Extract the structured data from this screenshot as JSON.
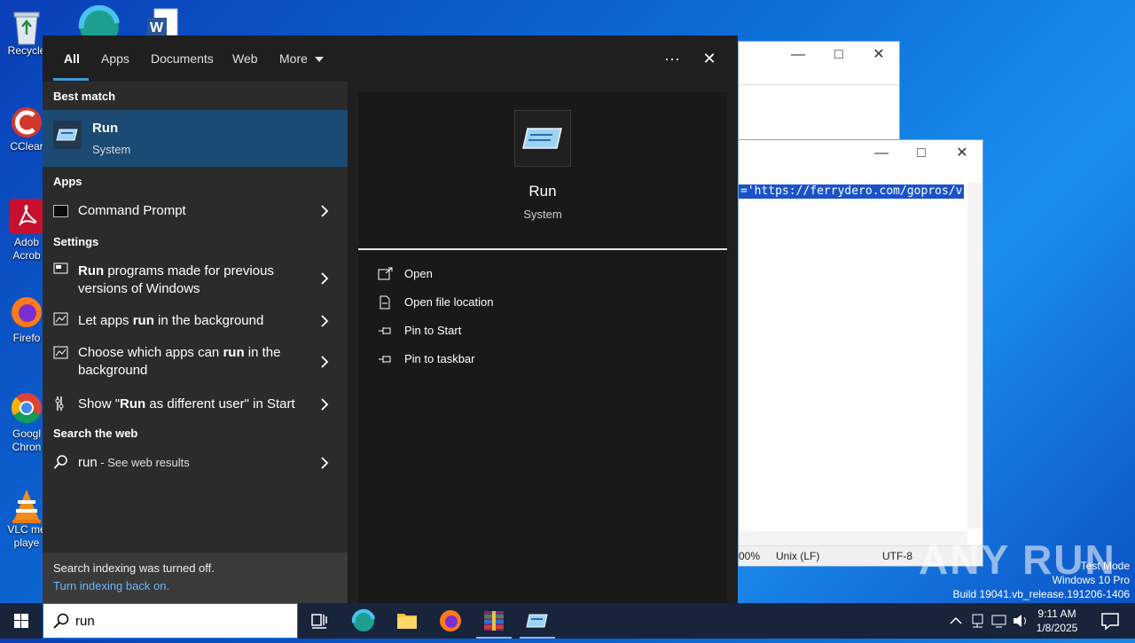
{
  "desktop": {
    "icons": [
      {
        "label": "Recycle",
        "name": "recycle-bin-icon"
      },
      {
        "label": "CClear",
        "name": "ccleaner-icon"
      },
      {
        "label": "Adob\nAcrob",
        "name": "acrobat-icon"
      },
      {
        "label": "Firefo",
        "name": "firefox-icon"
      },
      {
        "label": "Googl\nChron",
        "name": "chrome-icon"
      },
      {
        "label": "VLC me\nplaye",
        "name": "vlc-icon"
      }
    ]
  },
  "bg_window": {
    "url_text": "='https://ferrydero.com/gopros/v",
    "status": {
      "zoom": "00%",
      "eol": "Unix (LF)",
      "encoding": "UTF-8"
    }
  },
  "search_panel": {
    "tabs": {
      "all": "All",
      "apps": "Apps",
      "documents": "Documents",
      "web": "Web",
      "more": "More"
    },
    "header": {
      "more_options": "···",
      "close": "✕"
    },
    "sections": {
      "best_match": "Best match",
      "apps": "Apps",
      "settings": "Settings",
      "search_web": "Search the web"
    },
    "best_match": {
      "title": "Run",
      "subtitle": "System"
    },
    "apps": [
      {
        "label": "Command Prompt"
      }
    ],
    "settings": [
      {
        "pre": "",
        "bold": "Run",
        "post": " programs made for previous versions of Windows"
      },
      {
        "pre": "Let apps ",
        "bold": "run",
        "post": " in the background"
      },
      {
        "pre": "Choose which apps can ",
        "bold": "run",
        "post": " in the background"
      },
      {
        "pre": "Show \"",
        "bold": "Run",
        "post": " as different user\" in Start"
      }
    ],
    "web": {
      "query": "run",
      "suffix": " - See web results"
    },
    "footer": {
      "notice": "Search indexing was turned off.",
      "link": "Turn indexing back on."
    },
    "detail": {
      "title": "Run",
      "subtitle": "System",
      "actions": [
        "Open",
        "Open file location",
        "Pin to Start",
        "Pin to taskbar"
      ]
    }
  },
  "taskbar": {
    "search_value": "run",
    "clock_time": "9:11 AM",
    "clock_date": "1/8/2025"
  },
  "watermark": {
    "brand": "ANY RUN",
    "line1": "Test Mode",
    "line2": "Windows 10 Pro",
    "line3": "Build 19041.vb_release.191206-1406"
  }
}
